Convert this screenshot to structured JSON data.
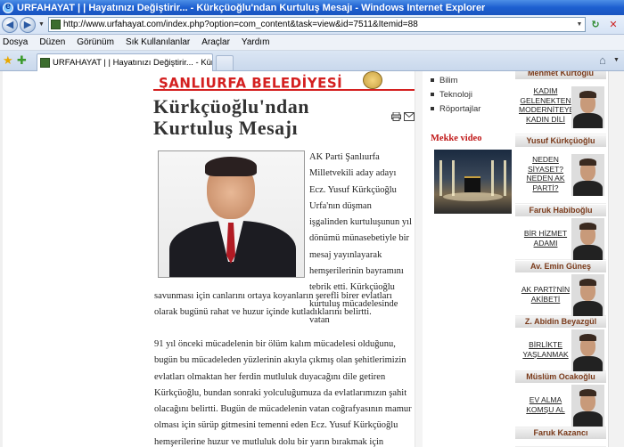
{
  "window": {
    "title": "URFAHAYAT | | Hayatınızı Değiştirir... - Kürkçüoğlu'ndan Kurtuluş Mesajı - Windows Internet Explorer"
  },
  "address": {
    "url": "http://www.urfahayat.com/index.php?option=com_content&task=view&id=7511&Itemid=88"
  },
  "menu": {
    "items": [
      "Dosya",
      "Düzen",
      "Görünüm",
      "Sık Kullanılanlar",
      "Araçlar",
      "Yardım"
    ]
  },
  "tabs": {
    "active_label": "URFAHAYAT | | Hayatınızı Değiştirir... - Kürkçüoğlu'nda..."
  },
  "banner": {
    "text": "ŞANLIURFA BELEDİYESİ"
  },
  "article": {
    "title": "Kürkçüoğlu'ndan Kurtuluş Mesajı",
    "p1": "AK Parti Şanlıurfa Milletvekili aday adayı Ecz. Yusuf Kürkçüoğlu Urfa'nın düşman işgalinden kurtuluşunun yıl dönümü münasebetiyle bir mesaj yayınlayarak hemşerilerinin bayramını tebrik etti. Kürkçüoğlu kurtuluş mücadelesinde vatan",
    "p2": "savunması için canlarını ortaya koyanların şerefli birer evlatları olarak bugünü rahat ve huzur içinde kutladıklarını belirtti.",
    "p3": "91 yıl önceki mücadelenin bir ölüm kalım mücadelesi olduğunu, bugün bu mücadeleden yüzlerinin akıyla çıkmış olan şehitlerimizin evlatları olmaktan her ferdin mutluluk duyacağını dile getiren Kürkçüoğlu, bundan sonraki yolculuğumuza da evlatlarımızın şahit olacağını belirtti. Bugün de mücadelenin vatan coğrafyasının mamur olması için sürüp gitmesini temenni eden Ecz. Yusuf Kürkçüoğlu hemşerilerine huzur ve mutluluk dolu bir yarın bırakmak için çalıştıklarını vurguladı."
  },
  "categories": [
    "Bilim",
    "Teknoloji",
    "Röportajlar"
  ],
  "video": {
    "label": "Mekke video"
  },
  "authors": [
    {
      "name": "Mehmet Kurtoğlu",
      "link": "KADIM GELENEKTEN MODERNİTEYE KADIN DİLİ"
    },
    {
      "name": "Yusuf Kürkçüoğlu",
      "link": "NEDEN SİYASET? NEDEN AK PARTİ?"
    },
    {
      "name": "Faruk Habiboğlu",
      "link": "BİR HİZMET ADAMI"
    },
    {
      "name": "Av. Emin Güneş",
      "link": "AK PARTİ'NİN AKİBETİ"
    },
    {
      "name": "Z. Abidin Beyazgül",
      "link": "BİRLİKTE YAŞLANMAK"
    },
    {
      "name": "Müslüm Ocakoğlu",
      "link": "EV ALMA KOMŞU AL"
    },
    {
      "name": "Faruk Kazancı",
      "link": ""
    }
  ],
  "colors": {
    "titlebar": "#1d5fd0",
    "banner_red": "#d42020",
    "video_label": "#c01818",
    "author_name": "#7a3a1a"
  }
}
